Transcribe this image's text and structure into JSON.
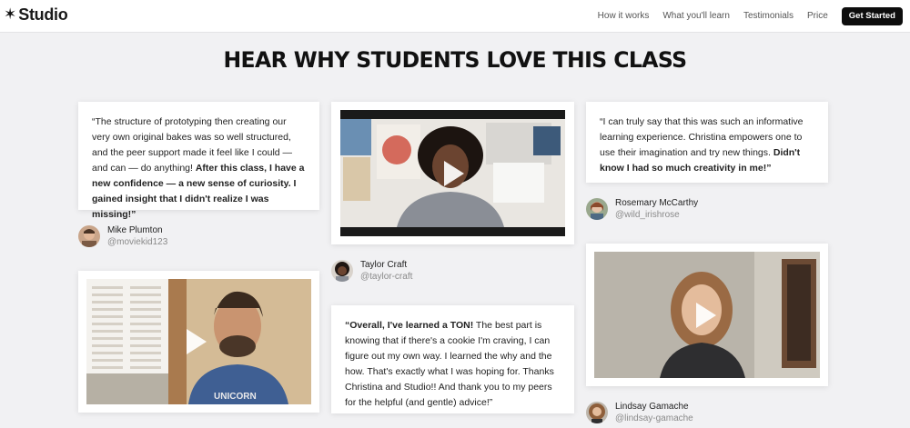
{
  "brand": {
    "logo_glyph": "✶",
    "name": "Studio"
  },
  "nav": {
    "links": [
      "How it works",
      "What you'll learn",
      "Testimonials",
      "Price"
    ],
    "cta": "Get Started"
  },
  "headline": "HEAR WHY STUDENTS LOVE THIS CLASS",
  "testimonials": [
    {
      "quote_plain": "“The structure of prototyping then creating our very own original bakes was so well structured, and the peer support made it feel like I could — and can — do anything! ",
      "quote_bold": "After this class, I have a new confidence — a new sense of curiosity. I gained insight that I didn't realize I was missing!”",
      "name": "Mike Plumton",
      "handle": "@moviekid123"
    },
    {
      "quote_plain": "“I can truly say that this was such an informative learning experience. Christina empowers one to use their imagination and try new things. ",
      "quote_bold": "Didn't know I had so much creativity in me!”",
      "name": "Rosemary McCarthy",
      "handle": "@wild_irishrose"
    },
    {
      "quote_bold_lead": "“Overall, I've learned a TON!",
      "quote_plain": " The best part is knowing that if there's a cookie I'm craving, I can figure out my own way. I learned the why and the how. That's exactly what I was hoping for. Thanks Christina and Studio!! And thank you to my peers for the helpful (and gentle) advice!”",
      "name": "Taylor Craft",
      "handle": "@taylor-craft"
    }
  ],
  "video_authors": [
    {
      "name": "Taylor Craft",
      "handle": "@taylor-craft"
    },
    {
      "name": "Lindsay Gamache",
      "handle": "@lindsay-gamache"
    }
  ],
  "shirt_text": "UNICORN",
  "icons": [
    "star-logo-icon",
    "play-icon"
  ]
}
